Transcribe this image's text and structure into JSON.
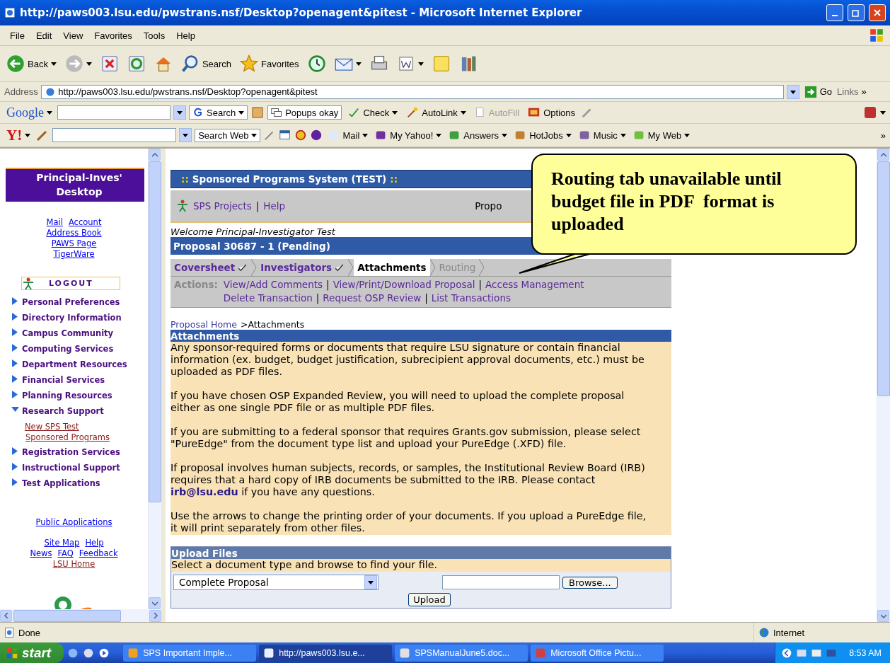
{
  "window": {
    "title": "http://paws003.lsu.edu/pwstrans.nsf/Desktop?openagent&pitest - Microsoft Internet Explorer"
  },
  "menu": [
    "File",
    "Edit",
    "View",
    "Favorites",
    "Tools",
    "Help"
  ],
  "toolbar": [
    {
      "kind": "back",
      "label": "Back",
      "dropdown": true
    },
    {
      "kind": "forward",
      "dropdown": true
    },
    {
      "kind": "stop"
    },
    {
      "kind": "refresh"
    },
    {
      "kind": "home"
    },
    {
      "kind": "search",
      "label": "Search"
    },
    {
      "kind": "favorites",
      "label": "Favorites"
    },
    {
      "kind": "history"
    },
    {
      "kind": "mail",
      "dropdown": true
    },
    {
      "kind": "print"
    },
    {
      "kind": "edit",
      "dropdown": true
    },
    {
      "kind": "note"
    },
    {
      "kind": "research"
    }
  ],
  "address": {
    "label": "Address",
    "url": "http://paws003.lsu.edu/pwstrans.nsf/Desktop?openagent&pitest",
    "go": "Go",
    "links": "Links",
    "more": "»"
  },
  "google": {
    "brand": "Google",
    "search": "Search",
    "popups": "Popups okay",
    "check": "Check",
    "autolink": "AutoLink",
    "autofill": {
      "label": "AutoFill",
      "disabled": true
    },
    "options": "Options"
  },
  "yahoo": {
    "brand": "Y!",
    "search": "Search Web",
    "items": [
      "Mail",
      "My Yahoo!",
      "Answers",
      "HotJobs",
      "Music",
      "My Web"
    ],
    "more": "»"
  },
  "sidebar": {
    "title": "Principal-Inves' Desktop",
    "top_links": [
      [
        "Mail",
        "Account"
      ],
      [
        "Address Book"
      ],
      [
        "PAWS Page"
      ],
      [
        "TigerWare"
      ]
    ],
    "logout": "LOGOUT",
    "nav": [
      {
        "label": "Personal Preferences",
        "expanded": false
      },
      {
        "label": "Directory Information",
        "expanded": false
      },
      {
        "label": "Campus Community",
        "expanded": false
      },
      {
        "label": "Computing Services",
        "expanded": false
      },
      {
        "label": "Department Resources",
        "expanded": false
      },
      {
        "label": "Financial Services",
        "expanded": false
      },
      {
        "label": "Planning Resources",
        "expanded": false
      },
      {
        "label": "Research Support",
        "expanded": true,
        "children": [
          {
            "label": "New SPS Test"
          },
          {
            "label": "Sponsored Programs"
          }
        ]
      },
      {
        "label": "Registration Services",
        "expanded": false
      },
      {
        "label": "Instructional Support",
        "expanded": false
      },
      {
        "label": "Test Applications",
        "expanded": false
      }
    ],
    "public_link": "Public Applications",
    "footer_links": [
      [
        {
          "label": "Site Map",
          "visited": false
        },
        {
          "label": "Help",
          "visited": false
        }
      ],
      [
        {
          "label": "News",
          "visited": false
        },
        {
          "label": "FAQ",
          "visited": false
        },
        {
          "label": "Feedback",
          "visited": false
        }
      ],
      [
        {
          "label": "LSU Home",
          "visited": true
        }
      ]
    ]
  },
  "app": {
    "title": "Sponsored Programs System (TEST)",
    "prefix": "::",
    "suffix": "::",
    "links": [
      "SPS Projects",
      "Help"
    ],
    "separator": "|",
    "partial": "Propo"
  },
  "welcome": "Welcome Principal-Investigator Test",
  "proposal": "Proposal 30687 - 1 (Pending)",
  "tabs": [
    {
      "label": "Coversheet",
      "complete": true,
      "selected": false,
      "disabled": false
    },
    {
      "label": "Investigators",
      "complete": true,
      "selected": false,
      "disabled": false
    },
    {
      "label": "Attachments",
      "complete": false,
      "selected": true,
      "disabled": false
    },
    {
      "label": "Routing",
      "complete": false,
      "selected": false,
      "disabled": true
    }
  ],
  "actions": {
    "label": "Actions:",
    "rows": [
      [
        "View/Add Comments",
        "View/Print/Download Proposal",
        "Access Management"
      ],
      [
        "Delete Transaction",
        "Request OSP Review",
        "List Transactions"
      ]
    ]
  },
  "breadcrumb": {
    "link": "Proposal Home",
    "current": ">Attachments"
  },
  "attachments": {
    "title": "Attachments",
    "paragraphs": [
      {
        "text": "Any sponsor-required forms or documents that require LSU signature or contain financial information (ex. budget, budget justification, subrecipient approval documents, etc.) must be uploaded as PDF files."
      },
      {
        "text": "If you have chosen OSP Expanded Review, you will need to upload the complete proposal either as one single PDF file or as multiple PDF files."
      },
      {
        "text": "If you are submitting to a federal sponsor that requires Grants.gov submission, please select \"PureEdge\" from the document type list and upload your PureEdge (.XFD) file."
      },
      {
        "text": "If proposal involves human subjects, records, or samples, the Institutional Review Board (IRB) requires that a hard copy of IRB documents be submitted to the IRB. Please contact",
        "link": "irb@lsu.edu",
        "after": "if you have any questions."
      },
      {
        "text": "Use the arrows to change the printing order of your documents. If you upload a PureEdge file, it will print separately from other files."
      }
    ]
  },
  "upload": {
    "title": "Upload Files",
    "hint": "Select a document type and browse to find your file.",
    "doc_type": "Complete Proposal",
    "browse": "Browse...",
    "submit": "Upload"
  },
  "callout": "Routing tab unavailable until budget file in PDF  format is uploaded",
  "status_bar": {
    "text": "Done",
    "zone": "Internet"
  },
  "taskbar": {
    "start": "start",
    "tasks": [
      {
        "label": "SPS Important Imple...",
        "selected": false
      },
      {
        "label": "http://paws003.lsu.e...",
        "selected": true
      },
      {
        "label": "SPSManualJune5.doc...",
        "selected": false
      },
      {
        "label": "Microsoft Office Pictu...",
        "selected": false
      }
    ],
    "time": "8:53 AM"
  }
}
